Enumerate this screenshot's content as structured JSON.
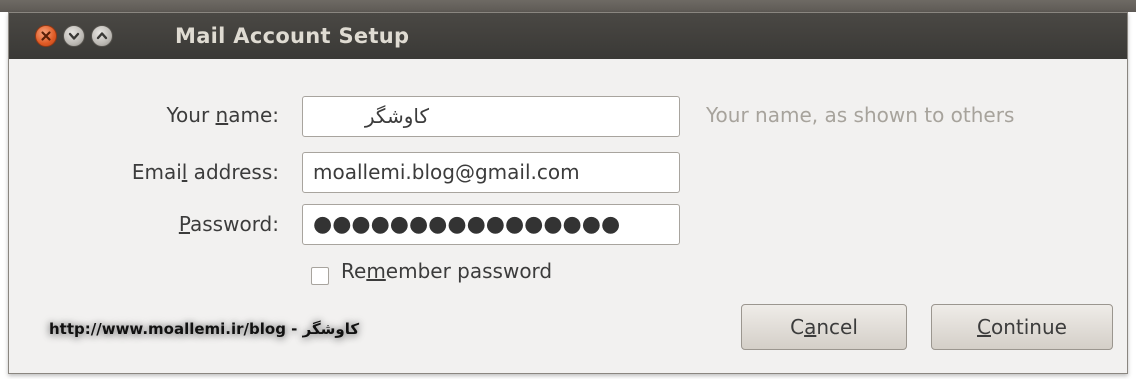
{
  "window": {
    "title": "Mail Account Setup"
  },
  "form": {
    "name": {
      "label_prefix": "Your ",
      "label_mnemonic": "n",
      "label_suffix": "ame:",
      "value": "کاوشگر",
      "hint": "Your name, as shown to others"
    },
    "email": {
      "label_prefix": "Emai",
      "label_mnemonic": "l",
      "label_suffix": " address:",
      "value": "moallemi.blog@gmail.com"
    },
    "password": {
      "label_prefix": "",
      "label_mnemonic": "P",
      "label_suffix": "assword:",
      "value": "●●●●●●●●●●●●●●●●"
    },
    "remember": {
      "label_prefix": "Re",
      "label_mnemonic": "m",
      "label_suffix": "ember password",
      "checked": false
    }
  },
  "buttons": {
    "cancel": {
      "label_prefix": "C",
      "label_mnemonic": "a",
      "label_suffix": "ncel"
    },
    "continue": {
      "label_prefix": "",
      "label_mnemonic": "C",
      "label_suffix": "ontinue"
    }
  },
  "watermark": {
    "text": "http://www.moallemi.ir/blog - کاوشگر"
  },
  "icons": {
    "close": "close-icon",
    "minimize": "minimize-icon",
    "maximize": "maximize-icon"
  },
  "colors": {
    "titlebar": "#3c3b37",
    "close_button": "#e05a24",
    "hint_text": "#a7a39c"
  }
}
